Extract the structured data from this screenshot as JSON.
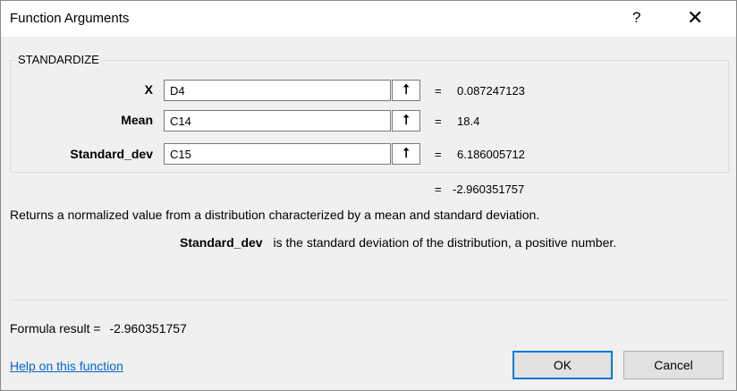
{
  "dialog": {
    "title": "Function Arguments",
    "help_glyph": "?",
    "close_glyph": "✕"
  },
  "function": {
    "name": "STANDARDIZE"
  },
  "arguments": [
    {
      "label": "X",
      "value": "D4",
      "eq": "=",
      "result": "0.087247123"
    },
    {
      "label": "Mean",
      "value": "C14",
      "eq": "=",
      "result": "18.4"
    },
    {
      "label": "Standard_dev",
      "value": "C15",
      "eq": "=",
      "result": "6.186005712"
    }
  ],
  "ref_button_glyph": "⭡",
  "overall": {
    "eq": "=",
    "result": "-2.960351757"
  },
  "description": "Returns a normalized value from a distribution characterized by a mean and standard deviation.",
  "arg_help": {
    "name": "Standard_dev",
    "text": "is the standard deviation of the distribution, a positive number."
  },
  "formula": {
    "label": "Formula result =",
    "value": "-2.960351757"
  },
  "help_link": "Help on this function",
  "buttons": {
    "ok": "OK",
    "cancel": "Cancel"
  }
}
